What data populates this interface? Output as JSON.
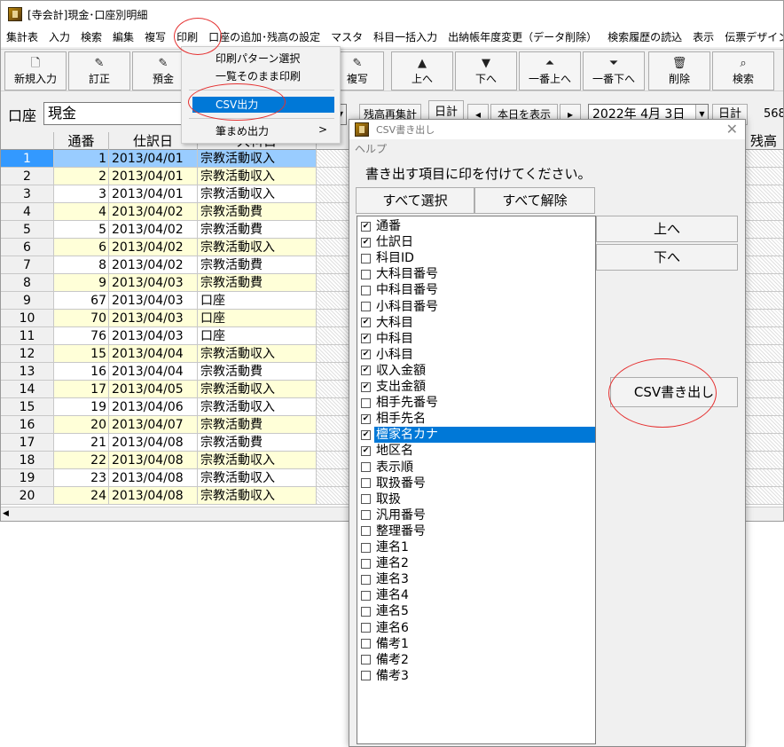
{
  "window": {
    "title": "[寺会計]現金･口座別明細"
  },
  "menubar": [
    "集計表",
    "入力",
    "検索",
    "編集",
    "複写",
    "印刷",
    "口座の追加･残高の設定",
    "マスタ",
    "科目一括入力",
    "出納帳年度変更（データ削除）",
    "検索履歴の読込",
    "表示",
    "伝票デザイン試"
  ],
  "print_menu": {
    "items": [
      "印刷パターン選択",
      "一覧そのまま印刷",
      "CSV出力",
      "筆まめ出力"
    ],
    "submenu_arrow": ">"
  },
  "toolbar": [
    {
      "label": "新規入力",
      "icon": "new-document-icon",
      "glyph": "🗋"
    },
    {
      "label": "訂正",
      "icon": "pencil-icon",
      "glyph": "✎"
    },
    {
      "label": "預金",
      "icon": "pencil-icon",
      "glyph": "✎"
    },
    {
      "label": "複写",
      "icon": "pencil-icon",
      "glyph": "✎"
    },
    {
      "label": "上へ",
      "icon": "arrow-up-icon",
      "glyph": "▲"
    },
    {
      "label": "下へ",
      "icon": "arrow-down-icon",
      "glyph": "▼"
    },
    {
      "label": "一番上へ",
      "icon": "double-arrow-up-icon",
      "glyph": "⏶"
    },
    {
      "label": "一番下へ",
      "icon": "double-arrow-down-icon",
      "glyph": "⏷"
    },
    {
      "label": "削除",
      "icon": "trash-icon",
      "glyph": "🗑"
    },
    {
      "label": "検索",
      "icon": "magnifier-icon",
      "glyph": "⌕"
    }
  ],
  "filter": {
    "account_label": "口座",
    "account_value": "現金",
    "recalc_label": "残高再集計",
    "daily_label": "日計",
    "prev": "◂",
    "show_today": "本日を表示",
    "next": "▸",
    "date_value": "2022年 4月 3日",
    "daily2": "日計",
    "count": "568"
  },
  "grid": {
    "headers": [
      "通番",
      "仕訳日",
      "大科目",
      "残高"
    ],
    "rows": [
      {
        "idx": "1",
        "no": "1",
        "date": "2013/04/01",
        "subject": "宗教活動収入"
      },
      {
        "idx": "2",
        "no": "2",
        "date": "2013/04/01",
        "subject": "宗教活動収入"
      },
      {
        "idx": "3",
        "no": "3",
        "date": "2013/04/01",
        "subject": "宗教活動収入"
      },
      {
        "idx": "4",
        "no": "4",
        "date": "2013/04/02",
        "subject": "宗教活動費"
      },
      {
        "idx": "5",
        "no": "5",
        "date": "2013/04/02",
        "subject": "宗教活動費"
      },
      {
        "idx": "6",
        "no": "6",
        "date": "2013/04/02",
        "subject": "宗教活動収入"
      },
      {
        "idx": "7",
        "no": "8",
        "date": "2013/04/02",
        "subject": "宗教活動費"
      },
      {
        "idx": "8",
        "no": "9",
        "date": "2013/04/03",
        "subject": "宗教活動費"
      },
      {
        "idx": "9",
        "no": "67",
        "date": "2013/04/03",
        "subject": "口座"
      },
      {
        "idx": "10",
        "no": "70",
        "date": "2013/04/03",
        "subject": "口座"
      },
      {
        "idx": "11",
        "no": "76",
        "date": "2013/04/03",
        "subject": "口座"
      },
      {
        "idx": "12",
        "no": "15",
        "date": "2013/04/04",
        "subject": "宗教活動収入"
      },
      {
        "idx": "13",
        "no": "16",
        "date": "2013/04/04",
        "subject": "宗教活動費"
      },
      {
        "idx": "14",
        "no": "17",
        "date": "2013/04/05",
        "subject": "宗教活動収入"
      },
      {
        "idx": "15",
        "no": "19",
        "date": "2013/04/06",
        "subject": "宗教活動収入"
      },
      {
        "idx": "16",
        "no": "20",
        "date": "2013/04/07",
        "subject": "宗教活動費"
      },
      {
        "idx": "17",
        "no": "21",
        "date": "2013/04/08",
        "subject": "宗教活動費"
      },
      {
        "idx": "18",
        "no": "22",
        "date": "2013/04/08",
        "subject": "宗教活動収入"
      },
      {
        "idx": "19",
        "no": "23",
        "date": "2013/04/08",
        "subject": "宗教活動収入"
      },
      {
        "idx": "20",
        "no": "24",
        "date": "2013/04/08",
        "subject": "宗教活動収入"
      }
    ]
  },
  "csv_dialog": {
    "title": "CSV書き出し",
    "menu": "ヘルプ",
    "close": "✕",
    "instruction": "書き出す項目に印を付けてください。",
    "select_all": "すべて選択",
    "deselect_all": "すべて解除",
    "up": "上へ",
    "down": "下へ",
    "export": "CSV書き出し",
    "fields": [
      {
        "label": "通番",
        "checked": true
      },
      {
        "label": "仕訳日",
        "checked": true
      },
      {
        "label": "科目ID",
        "checked": false
      },
      {
        "label": "大科目番号",
        "checked": false
      },
      {
        "label": "中科目番号",
        "checked": false
      },
      {
        "label": "小科目番号",
        "checked": false
      },
      {
        "label": "大科目",
        "checked": true
      },
      {
        "label": "中科目",
        "checked": true
      },
      {
        "label": "小科目",
        "checked": true
      },
      {
        "label": "収入金額",
        "checked": true
      },
      {
        "label": "支出金額",
        "checked": true
      },
      {
        "label": "相手先番号",
        "checked": false
      },
      {
        "label": "相手先名",
        "checked": true
      },
      {
        "label": "檀家名カナ",
        "checked": true
      },
      {
        "label": "地区名",
        "checked": true
      },
      {
        "label": "表示順",
        "checked": false
      },
      {
        "label": "取扱番号",
        "checked": false
      },
      {
        "label": "取扱",
        "checked": false
      },
      {
        "label": "汎用番号",
        "checked": false
      },
      {
        "label": "整理番号",
        "checked": false
      },
      {
        "label": "連名1",
        "checked": false
      },
      {
        "label": "連名2",
        "checked": false
      },
      {
        "label": "連名3",
        "checked": false
      },
      {
        "label": "連名4",
        "checked": false
      },
      {
        "label": "連名5",
        "checked": false
      },
      {
        "label": "連名6",
        "checked": false
      },
      {
        "label": "備考1",
        "checked": false
      },
      {
        "label": "備考2",
        "checked": false
      },
      {
        "label": "備考3",
        "checked": false
      }
    ],
    "selected_field": "檀家名カナ"
  },
  "colors": {
    "selection": "#0078d7",
    "row_yellow": "#ffffd8",
    "annotation": "#e53030"
  }
}
